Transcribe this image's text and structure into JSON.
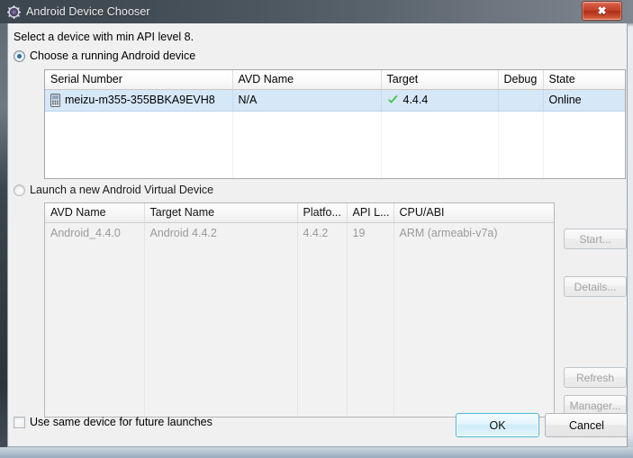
{
  "window": {
    "title": "Android Device Chooser",
    "title_icon": "gear-icon",
    "close_label": "✖"
  },
  "dialog": {
    "hint": "Select a device with min API level 8.",
    "running_device_option": "Choose a running Android device",
    "new_avd_option": "Launch a new Android Virtual Device"
  },
  "device_table": {
    "columns": [
      "Serial Number",
      "AVD Name",
      "Target",
      "Debug",
      "State"
    ],
    "rows": [
      {
        "serial": "meizu-m355-355BBKA9EVH8",
        "avd_name": "N/A",
        "target": "4.4.4",
        "target_icon": "green-check-icon",
        "debug": "",
        "state": "Online",
        "selected": true
      }
    ],
    "empty_row_count": 3
  },
  "avd_table": {
    "columns": [
      "AVD Name",
      "Target Name",
      "Platfo...",
      "API L...",
      "CPU/ABI"
    ],
    "rows": [
      {
        "avd_name": "Android_4.4.0",
        "target_name": "Android 4.4.2",
        "platform": "4.4.2",
        "api_level": "19",
        "cpu_abi": "ARM (armeabi-v7a)"
      }
    ],
    "empty_row_count": 8
  },
  "side_buttons": {
    "start": "Start...",
    "details": "Details...",
    "refresh": "Refresh",
    "manager": "Manager..."
  },
  "footer": {
    "use_same_device": "Use same device for future launches",
    "ok": "OK",
    "cancel": "Cancel"
  },
  "colors": {
    "selection": "#d6e7f8",
    "ok_accent": "#49b7d6",
    "check_green": "#3ac13a",
    "close_red": "#c23d26",
    "titlebar": "#4d575f"
  }
}
